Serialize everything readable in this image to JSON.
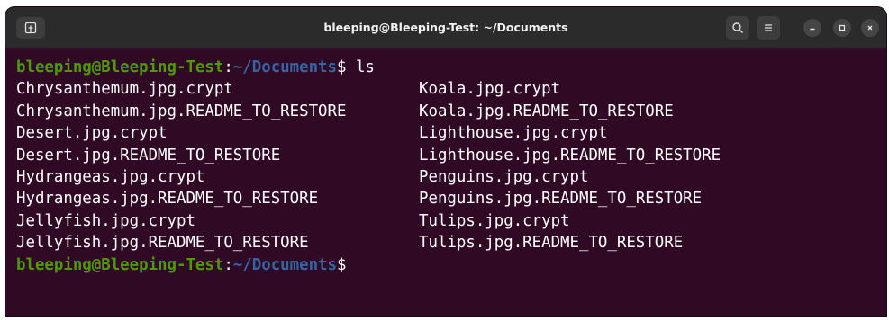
{
  "window": {
    "title": "bleeping@Bleeping-Test: ~/Documents"
  },
  "colors": {
    "background": "#300a24",
    "user_host": "#4e9a06",
    "path": "#3465a4",
    "text": "#ffffff",
    "titlebar": "#2b2b2b"
  },
  "icons": {
    "new_tab": "new-tab-icon",
    "search": "search-icon",
    "menu": "hamburger-menu-icon",
    "minimize": "minimize-icon",
    "maximize": "maximize-icon",
    "close": "close-icon"
  },
  "prompt1": {
    "user_host": "bleeping@Bleeping-Test",
    "colon": ":",
    "path": "~/Documents",
    "dollar": "$",
    "command": " ls"
  },
  "files": [
    {
      "left": "Chrysanthemum.jpg.crypt",
      "right": "Koala.jpg.crypt"
    },
    {
      "left": "Chrysanthemum.jpg.README_TO_RESTORE",
      "right": "Koala.jpg.README_TO_RESTORE"
    },
    {
      "left": "Desert.jpg.crypt",
      "right": "Lighthouse.jpg.crypt"
    },
    {
      "left": "Desert.jpg.README_TO_RESTORE",
      "right": "Lighthouse.jpg.README_TO_RESTORE"
    },
    {
      "left": "Hydrangeas.jpg.crypt",
      "right": "Penguins.jpg.crypt"
    },
    {
      "left": "Hydrangeas.jpg.README_TO_RESTORE",
      "right": "Penguins.jpg.README_TO_RESTORE"
    },
    {
      "left": "Jellyfish.jpg.crypt",
      "right": "Tulips.jpg.crypt"
    },
    {
      "left": "Jellyfish.jpg.README_TO_RESTORE",
      "right": "Tulips.jpg.README_TO_RESTORE"
    }
  ],
  "prompt2": {
    "user_host": "bleeping@Bleeping-Test",
    "colon": ":",
    "path": "~/Documents",
    "dollar": "$"
  }
}
